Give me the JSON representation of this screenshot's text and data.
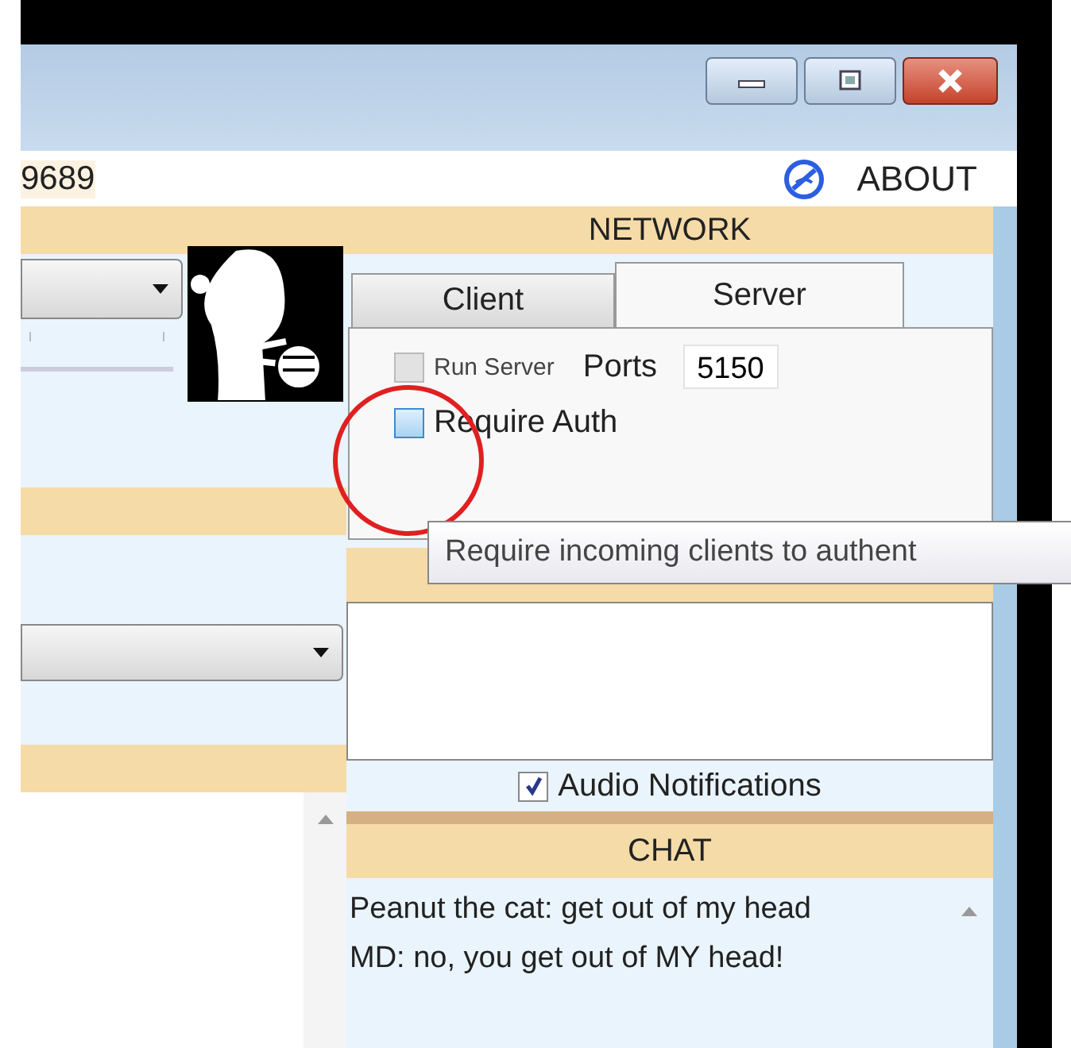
{
  "window": {
    "title_fragment": "9689"
  },
  "menu": {
    "about": "ABOUT"
  },
  "network": {
    "title": "NETWORK",
    "tabs": [
      {
        "label": "Client",
        "selected": false
      },
      {
        "label": "Server",
        "selected": true
      }
    ],
    "run_server": {
      "label": "Run Server",
      "checked": false,
      "disabled": true
    },
    "ports": {
      "label": "Ports",
      "value": "5150"
    },
    "require_auth": {
      "label": "Require Auth",
      "checked": false,
      "hovered": true
    },
    "tooltip": "Require incoming clients to authent"
  },
  "audio_notifications": {
    "label": "Audio Notifications",
    "checked": true
  },
  "chat": {
    "title": "CHAT",
    "messages": [
      "Peanut the cat: get out of my head",
      "MD: no, you get out of MY head!"
    ]
  }
}
